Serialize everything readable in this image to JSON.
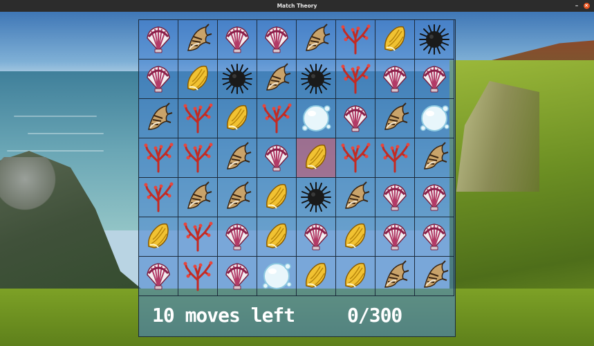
{
  "window": {
    "title": "Match Theory",
    "minimize_icon": "minimize-icon",
    "close_icon": "close-icon",
    "close_color": "#e95420"
  },
  "board": {
    "rows": 7,
    "cols": 8,
    "selected_cell": {
      "row": 3,
      "col": 4
    },
    "selected_color": "#cd5a6e",
    "tiles": [
      [
        "scallop",
        "conch",
        "scallop",
        "scallop",
        "conch",
        "coral",
        "snail",
        "urchin"
      ],
      [
        "scallop",
        "snail",
        "urchin",
        "conch",
        "urchin",
        "coral",
        "scallop",
        "scallop"
      ],
      [
        "conch",
        "coral",
        "snail",
        "coral",
        "bubble",
        "scallop",
        "conch",
        "bubble"
      ],
      [
        "coral",
        "coral",
        "conch",
        "scallop",
        "snail",
        "coral",
        "coral",
        "conch"
      ],
      [
        "coral",
        "conch",
        "conch",
        "snail",
        "urchin",
        "conch",
        "scallop",
        "scallop"
      ],
      [
        "snail",
        "coral",
        "scallop",
        "snail",
        "scallop",
        "snail",
        "scallop",
        "scallop"
      ],
      [
        "scallop",
        "coral",
        "scallop",
        "bubble",
        "snail",
        "snail",
        "conch",
        "conch"
      ]
    ]
  },
  "hud": {
    "moves_text": "10 moves left",
    "score_text": "0/300"
  }
}
